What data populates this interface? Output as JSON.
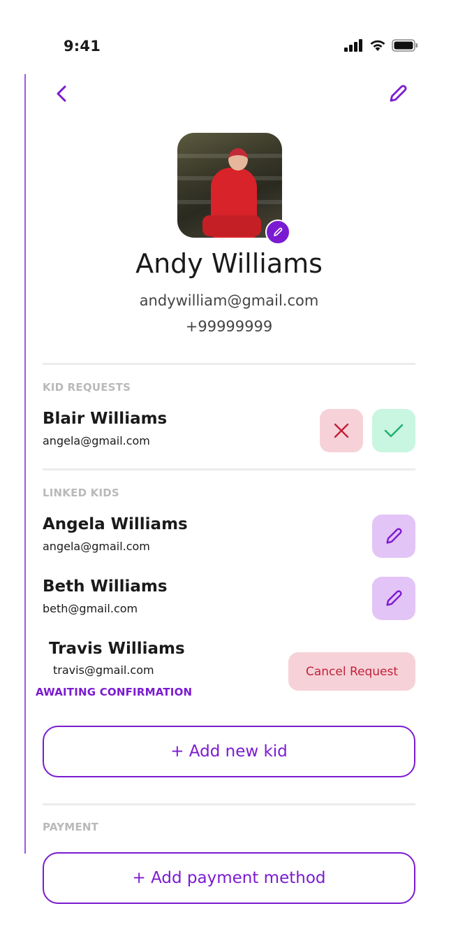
{
  "status_bar": {
    "time": "9:41"
  },
  "profile": {
    "name": "Andy Williams",
    "email": "andywilliam@gmail.com",
    "phone": "+99999999"
  },
  "kid_requests": {
    "label": "KID REQUESTS",
    "items": [
      {
        "name": "Blair Williams",
        "email": "angela@gmail.com"
      }
    ]
  },
  "linked_kids": {
    "label": "LINKED KIDS",
    "items": [
      {
        "name": "Angela Williams",
        "email": "angela@gmail.com"
      },
      {
        "name": "Beth Williams",
        "email": "beth@gmail.com"
      }
    ],
    "pending": {
      "name": "Travis Williams",
      "email": "travis@gmail.com",
      "status": "AWAITING CONFIRMATION",
      "cancel_label": "Cancel Request"
    },
    "add_label": "+ Add new kid"
  },
  "payment": {
    "label": "PAYMENT",
    "add_label": "+ Add payment method"
  },
  "colors": {
    "accent": "#7b1bd1",
    "reject_bg": "#f6d2d8",
    "accept_bg": "#c8f6e0",
    "edit_bg": "#e3c4f6"
  }
}
